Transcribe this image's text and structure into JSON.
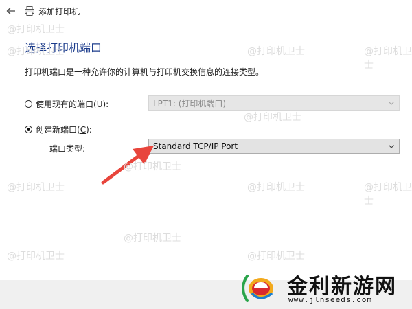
{
  "window": {
    "title": "添加打印机"
  },
  "heading": "选择打印机端口",
  "description": "打印机端口是一种允许你的计算机与打印机交换信息的连接类型。",
  "options": {
    "existing": {
      "label_prefix": "使用现有的端口(",
      "accel": "U",
      "label_suffix": "):",
      "checked": false,
      "value": "LPT1: (打印机端口)"
    },
    "create_new": {
      "label_prefix": "创建新端口(",
      "accel": "C",
      "label_suffix": "):",
      "checked": true
    }
  },
  "port_type": {
    "label": "端口类型:",
    "value": "Standard TCP/IP Port"
  },
  "watermark_text": "@打印机卫士",
  "brand": {
    "name": "金利新游网",
    "url": "www.jlnseeds.com"
  },
  "colors": {
    "heading": "#1c3c8c",
    "arrow": "#e8453c"
  },
  "icons": [
    "back-arrow-icon",
    "printer-icon",
    "chevron-down-icon",
    "red-arrow-icon"
  ]
}
